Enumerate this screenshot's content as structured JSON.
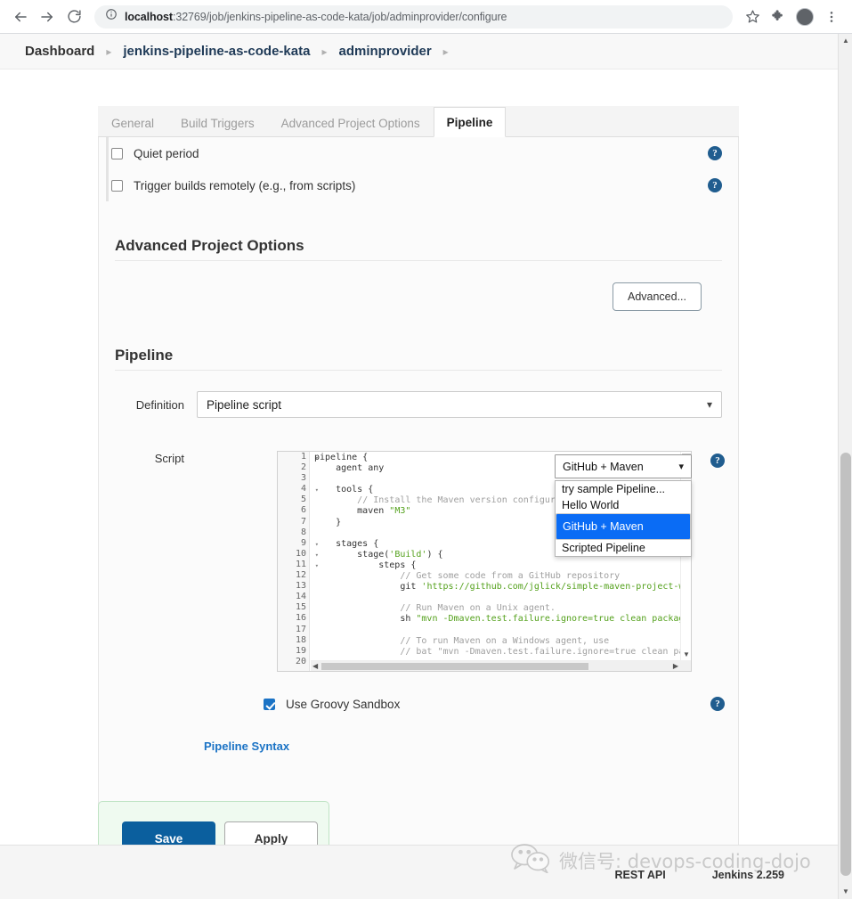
{
  "browser": {
    "back_icon": "arrow-left-icon",
    "forward_icon": "arrow-right-icon",
    "reload_icon": "reload-icon",
    "site_info_icon": "info-circle-icon",
    "url_host": "localhost",
    "url_rest": ":32769/job/jenkins-pipeline-as-code-kata/job/adminprovider/configure",
    "bookmark_icon": "star-icon",
    "extensions_icon": "puzzle-piece-icon",
    "profile_icon": "avatar-icon",
    "menu_icon": "three-dot-menu-icon"
  },
  "breadcrumb": {
    "items": [
      {
        "label": "Dashboard"
      },
      {
        "label": "jenkins-pipeline-as-code-kata"
      },
      {
        "label": "adminprovider"
      }
    ],
    "separator": "▸"
  },
  "tabs": [
    {
      "label": "General",
      "active": false
    },
    {
      "label": "Build Triggers",
      "active": false
    },
    {
      "label": "Advanced Project Options",
      "active": false
    },
    {
      "label": "Pipeline",
      "active": true
    }
  ],
  "triggers": {
    "checkboxes": [
      {
        "label": "Quiet period",
        "checked": false
      },
      {
        "label": "Trigger builds remotely (e.g., from scripts)",
        "checked": false
      }
    ],
    "help_glyph": "?"
  },
  "advanced_section": {
    "title": "Advanced Project Options",
    "advanced_button": "Advanced..."
  },
  "pipeline_section": {
    "title": "Pipeline",
    "definition_label": "Definition",
    "definition_value": "Pipeline script",
    "script_label": "Script",
    "sandbox_label": "Use Groovy Sandbox",
    "sandbox_checked": true,
    "pipeline_syntax_link": "Pipeline Syntax"
  },
  "sample_dropdown": {
    "selected": "GitHub + Maven",
    "open": true,
    "options": [
      {
        "label": "try sample Pipeline...",
        "selected": false
      },
      {
        "label": "Hello World",
        "selected": false
      },
      {
        "label": "GitHub + Maven",
        "selected": true
      },
      {
        "label": "Scripted Pipeline",
        "selected": false
      }
    ]
  },
  "editor": {
    "line_numbers": [
      "1",
      "2",
      "3",
      "4",
      "5",
      "6",
      "7",
      "8",
      "9",
      "10",
      "11",
      "12",
      "13",
      "14",
      "15",
      "16",
      "17",
      "18",
      "19",
      "20"
    ],
    "fold_lines": [
      1,
      4,
      9,
      10,
      11
    ],
    "fold_glyph": "▾",
    "lines": [
      [
        {
          "t": "pipeline {",
          "c": "tok"
        }
      ],
      [
        {
          "t": "    agent any",
          "c": "tok"
        }
      ],
      [
        {
          "t": "",
          "c": "tok"
        }
      ],
      [
        {
          "t": "    tools {",
          "c": "tok"
        }
      ],
      [
        {
          "t": "        ",
          "c": "tok"
        },
        {
          "t": "// Install the Maven version configured",
          "c": "com"
        }
      ],
      [
        {
          "t": "        maven ",
          "c": "tok"
        },
        {
          "t": "\"M3\"",
          "c": "str"
        }
      ],
      [
        {
          "t": "    }",
          "c": "tok"
        }
      ],
      [
        {
          "t": "",
          "c": "tok"
        }
      ],
      [
        {
          "t": "    stages {",
          "c": "tok"
        }
      ],
      [
        {
          "t": "        stage(",
          "c": "tok"
        },
        {
          "t": "'Build'",
          "c": "str"
        },
        {
          "t": ") {",
          "c": "tok"
        }
      ],
      [
        {
          "t": "            steps {",
          "c": "tok"
        }
      ],
      [
        {
          "t": "                ",
          "c": "tok"
        },
        {
          "t": "// Get some code from a GitHub repository",
          "c": "com"
        }
      ],
      [
        {
          "t": "                git ",
          "c": "tok"
        },
        {
          "t": "'https://github.com/jglick/simple-maven-project-wi",
          "c": "str"
        }
      ],
      [
        {
          "t": "",
          "c": "tok"
        }
      ],
      [
        {
          "t": "                ",
          "c": "tok"
        },
        {
          "t": "// Run Maven on a Unix agent.",
          "c": "com"
        }
      ],
      [
        {
          "t": "                sh ",
          "c": "tok"
        },
        {
          "t": "\"mvn -Dmaven.test.failure.ignore=true clean package",
          "c": "str"
        }
      ],
      [
        {
          "t": "",
          "c": "tok"
        }
      ],
      [
        {
          "t": "                ",
          "c": "tok"
        },
        {
          "t": "// To run Maven on a Windows agent, use",
          "c": "com"
        }
      ],
      [
        {
          "t": "                ",
          "c": "tok"
        },
        {
          "t": "// bat \"mvn -Dmaven.test.failure.ignore=true clean pac",
          "c": "com"
        }
      ],
      [
        {
          "t": "",
          "c": "tok"
        }
      ]
    ],
    "vscroll_down_glyph": "▼",
    "hscroll_left_glyph": "◀",
    "hscroll_right_glyph": "▶"
  },
  "save_bar": {
    "save_label": "Save",
    "apply_label": "Apply"
  },
  "footer": {
    "rest_api": "REST API",
    "version": "Jenkins 2.259"
  },
  "watermark": {
    "icon": "wechat-icon",
    "text": "微信号: devops-coding-dojo"
  },
  "scrollbar": {
    "up_glyph": "▲",
    "down_glyph": "▼"
  },
  "colors": {
    "accent_blue": "#1b73c5",
    "save_blue": "#0b5f9e",
    "highlight_blue": "#0a6cf5",
    "help_blue": "#205d8f",
    "save_bar_green": "#effaf0",
    "string_green": "#54a11c",
    "comment_gray": "#a0a0a0"
  }
}
